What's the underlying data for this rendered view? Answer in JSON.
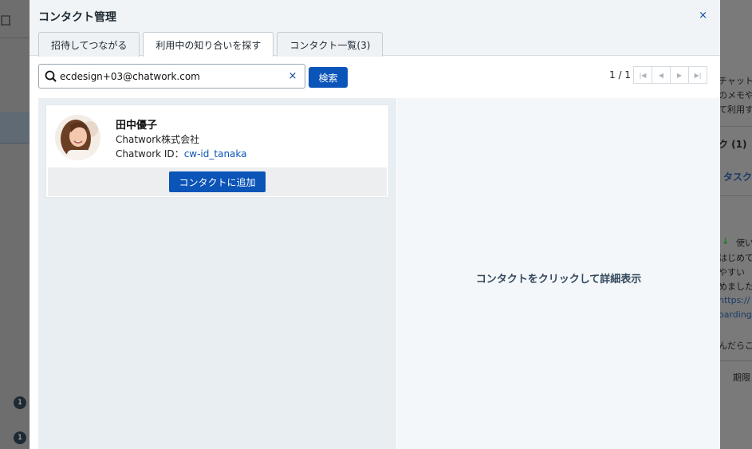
{
  "background": {
    "left_glyph": "囗",
    "left_counts": [
      "1",
      "1"
    ],
    "right_lines": [
      "チャット",
      "のメモや",
      "て利用す",
      "ク (1)",
      "タスク",
      "使い",
      "はじめて",
      "やすい",
      "めました",
      "https://",
      "oarding",
      "んだらこ",
      "期限"
    ]
  },
  "modal": {
    "title": "コンタクト管理",
    "close_label": "×",
    "tabs": [
      {
        "label": "招待してつながる"
      },
      {
        "label": "利用中の知り合いを探す"
      },
      {
        "label": "コンタクト一覧(3)"
      }
    ]
  },
  "search": {
    "value": "ecdesign+03@chatwork.com",
    "clear_label": "×",
    "button_label": "検索"
  },
  "pager": {
    "text": "1 / 1"
  },
  "result": {
    "name": "田中優子",
    "company": "Chatwork株式会社",
    "id_label": "Chatwork ID：",
    "id_value": "cw-id_tanaka",
    "add_button": "コンタクトに追加"
  },
  "detail": {
    "hint": "コンタクトをクリックして詳細表示"
  },
  "colors": {
    "primary": "#0b54b8",
    "header_bg": "#f1f4f6",
    "left_panel_bg": "#e9eef2"
  }
}
